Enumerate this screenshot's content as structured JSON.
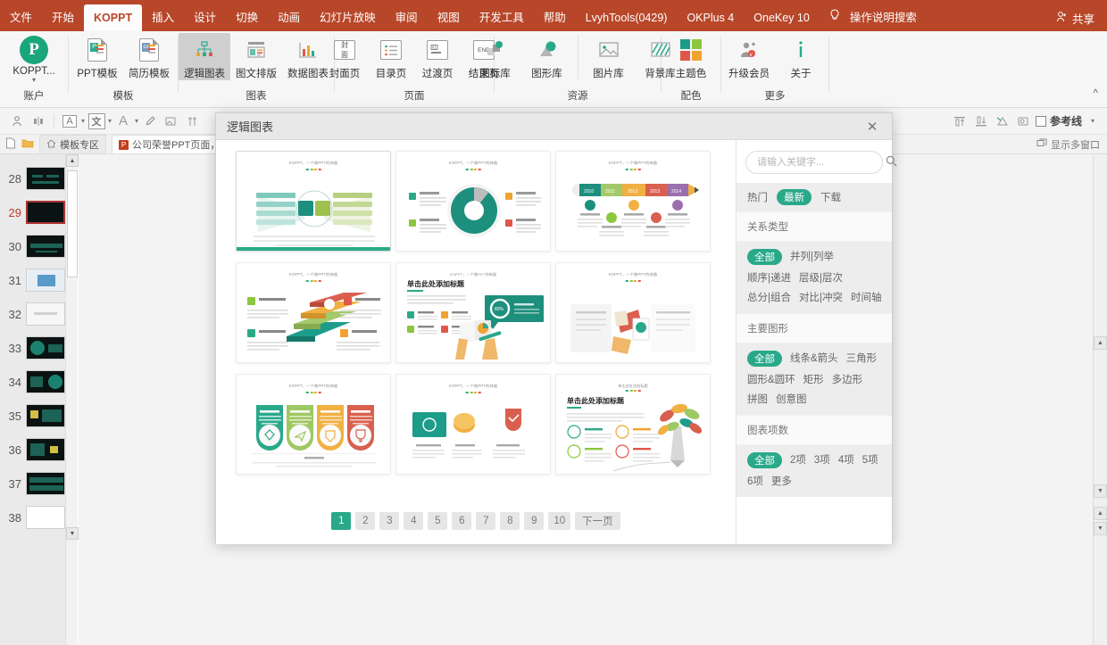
{
  "menubar": {
    "items": [
      {
        "label": "文件",
        "active": false
      },
      {
        "label": "开始",
        "active": false
      },
      {
        "label": "KOPPT",
        "active": true
      },
      {
        "label": "插入",
        "active": false
      },
      {
        "label": "设计",
        "active": false
      },
      {
        "label": "切换",
        "active": false
      },
      {
        "label": "动画",
        "active": false
      },
      {
        "label": "幻灯片放映",
        "active": false
      },
      {
        "label": "审阅",
        "active": false
      },
      {
        "label": "视图",
        "active": false
      },
      {
        "label": "开发工具",
        "active": false
      },
      {
        "label": "帮助",
        "active": false
      },
      {
        "label": "LvyhTools(0429)",
        "active": false
      },
      {
        "label": "OKPlus 4",
        "active": false
      },
      {
        "label": "OneKey 10",
        "active": false
      }
    ],
    "tell_me": "操作说明搜索",
    "share": "共享",
    "bg_color": "#b8472a",
    "active_color": "#b8472a"
  },
  "ribbon": {
    "collapse_icon": "^",
    "groups": [
      {
        "title": "账户",
        "items": [
          {
            "label": "KOPPT...",
            "icon": "koppt-logo-icon",
            "selected": false,
            "caret": true
          }
        ]
      },
      {
        "title": "模板",
        "items": [
          {
            "label": "PPT模板",
            "icon": "ppt-template-icon",
            "selected": false
          },
          {
            "label": "简历模板",
            "icon": "resume-template-icon",
            "selected": false
          }
        ]
      },
      {
        "title": "图表",
        "items": [
          {
            "label": "逻辑图表",
            "icon": "logic-chart-icon",
            "selected": true
          },
          {
            "label": "图文排版",
            "icon": "text-image-layout-icon",
            "selected": false
          },
          {
            "label": "数据图表",
            "icon": "data-chart-icon",
            "selected": false
          }
        ]
      },
      {
        "title": "页面",
        "items": [
          {
            "label": "封面页",
            "icon": "cover-page-icon",
            "selected": false
          },
          {
            "label": "目录页",
            "icon": "toc-page-icon",
            "selected": false
          },
          {
            "label": "过渡页",
            "icon": "transition-page-icon",
            "selected": false
          },
          {
            "label": "结束页",
            "icon": "end-page-icon",
            "selected": false
          }
        ]
      },
      {
        "title": "资源",
        "items": [
          {
            "label": "图标库",
            "icon": "icon-library-icon",
            "selected": false
          },
          {
            "label": "图形库",
            "icon": "shape-library-icon",
            "selected": false
          },
          {
            "label": "图片库",
            "icon": "image-library-icon",
            "selected": false
          },
          {
            "label": "背景库",
            "icon": "background-library-icon",
            "selected": false
          }
        ]
      },
      {
        "title": "配色",
        "items": [
          {
            "label": "主题色",
            "icon": "theme-color-icon",
            "selected": false
          }
        ]
      },
      {
        "title": "更多",
        "items": [
          {
            "label": "升级会员",
            "icon": "upgrade-member-icon",
            "selected": false
          },
          {
            "label": "关于",
            "icon": "about-info-icon",
            "selected": false
          }
        ]
      }
    ]
  },
  "toolbar2": {
    "guides_label": "参考线",
    "char_box": "文",
    "a_label": "A",
    "abox_label": "A"
  },
  "tabsrow": {
    "home_tab": "模板专区",
    "doc_tab": "公司荣誉PPT页面，这样设计即大气",
    "multiwindow": "显示多窗口"
  },
  "slidepane": {
    "slides": [
      {
        "num": "28",
        "current": false,
        "blank": false
      },
      {
        "num": "29",
        "current": true,
        "blank": false
      },
      {
        "num": "30",
        "current": false,
        "blank": false
      },
      {
        "num": "31",
        "current": false,
        "blank": false
      },
      {
        "num": "32",
        "current": false,
        "blank": false
      },
      {
        "num": "33",
        "current": false,
        "blank": false
      },
      {
        "num": "34",
        "current": false,
        "blank": false
      },
      {
        "num": "35",
        "current": false,
        "blank": false
      },
      {
        "num": "36",
        "current": false,
        "blank": false
      },
      {
        "num": "37",
        "current": false,
        "blank": false
      },
      {
        "num": "38",
        "current": false,
        "blank": true
      }
    ]
  },
  "dialog": {
    "title": "逻辑图表",
    "close_icon": "✕",
    "gallery": {
      "cards": [
        {
          "name": "mind-map-two-sided",
          "slide_title": "KOPPT，一个做PPT的神器",
          "selected": true
        },
        {
          "name": "donut-four-items",
          "slide_title": "KOPPT，一个做PPT的神器",
          "selected": false
        },
        {
          "name": "pencil-timeline",
          "slide_title": "KOPPT，一个做PPT的神器",
          "selected": false,
          "years": [
            "2010",
            "2011",
            "2012",
            "2013",
            "2014"
          ]
        },
        {
          "name": "stairs-three-layer",
          "slide_title": "KOPPT，一个做PPT的神器",
          "selected": false
        },
        {
          "name": "hands-chart-callout",
          "slide_title": "单击此处添加标题",
          "selected": false,
          "badge": "80%"
        },
        {
          "name": "clipboard-list",
          "slide_title": "KOPPT，一个做PPT的神器",
          "selected": false
        },
        {
          "name": "four-banner-icons",
          "slide_title": "KOPPT，一个做PPT的神器",
          "selected": false
        },
        {
          "name": "coins-shield-cards",
          "slide_title": "KOPPT，一个做PPT的神器",
          "selected": false
        },
        {
          "name": "pencil-tree",
          "slide_title": "单击此处添加标题",
          "selected": false
        }
      ],
      "pagination": {
        "pages": [
          "1",
          "2",
          "3",
          "4",
          "5",
          "6",
          "7",
          "8",
          "9",
          "10"
        ],
        "active": "1",
        "next_label": "下一页"
      }
    },
    "filters": {
      "search_placeholder": "请输入关键字...",
      "search_value": "",
      "search_icon": "search-icon",
      "sort": {
        "options": [
          {
            "label": "热门",
            "on": false
          },
          {
            "label": "最新",
            "on": true
          },
          {
            "label": "下载",
            "on": false
          }
        ]
      },
      "sections": [
        {
          "title": "关系类型",
          "chips": [
            {
              "label": "全部",
              "on": true
            },
            {
              "label": "并列|列举",
              "on": false
            },
            {
              "label": "顺序|递进",
              "on": false
            },
            {
              "label": "层级|层次",
              "on": false
            },
            {
              "label": "总分|组合",
              "on": false
            },
            {
              "label": "对比|冲突",
              "on": false
            },
            {
              "label": "时间轴",
              "on": false
            }
          ]
        },
        {
          "title": "主要图形",
          "chips": [
            {
              "label": "全部",
              "on": true
            },
            {
              "label": "线条&箭头",
              "on": false
            },
            {
              "label": "三角形",
              "on": false
            },
            {
              "label": "圆形&圆环",
              "on": false
            },
            {
              "label": "矩形",
              "on": false
            },
            {
              "label": "多边形",
              "on": false
            },
            {
              "label": "拼图",
              "on": false
            },
            {
              "label": "创意图",
              "on": false
            }
          ]
        },
        {
          "title": "图表项数",
          "chips": [
            {
              "label": "全部",
              "on": true
            },
            {
              "label": "2项",
              "on": false
            },
            {
              "label": "3项",
              "on": false
            },
            {
              "label": "4项",
              "on": false
            },
            {
              "label": "5项",
              "on": false
            },
            {
              "label": "6项",
              "on": false
            },
            {
              "label": "更多",
              "on": false
            }
          ]
        }
      ]
    }
  },
  "colors": {
    "accent_teal": "#2aa98a",
    "ribbon_red": "#b8472a",
    "panel_grey": "#ededed"
  }
}
